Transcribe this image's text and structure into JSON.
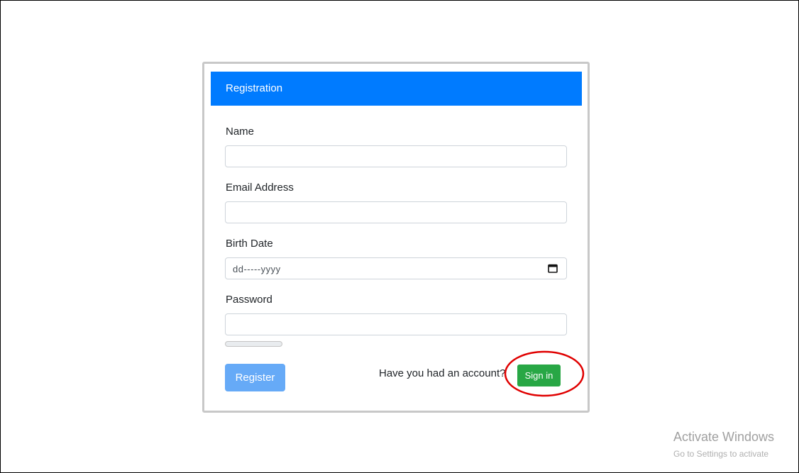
{
  "form": {
    "title": "Registration",
    "fields": {
      "name": {
        "label": "Name",
        "value": ""
      },
      "email": {
        "label": "Email Address",
        "value": ""
      },
      "birth_date": {
        "label": "Birth Date",
        "placeholder": "dd-----yyyy"
      },
      "password": {
        "label": "Password",
        "value": ""
      }
    },
    "password_strength": 0,
    "register_label": "Register",
    "account_prompt": "Have you had an account?",
    "signin_label": "Sign in"
  },
  "watermark": {
    "title": "Activate Windows",
    "subtitle": "Go to Settings to activate"
  },
  "colors": {
    "header": "#007bff",
    "register": "#66aaf7",
    "signin": "#28a745",
    "highlight": "#e00000"
  }
}
